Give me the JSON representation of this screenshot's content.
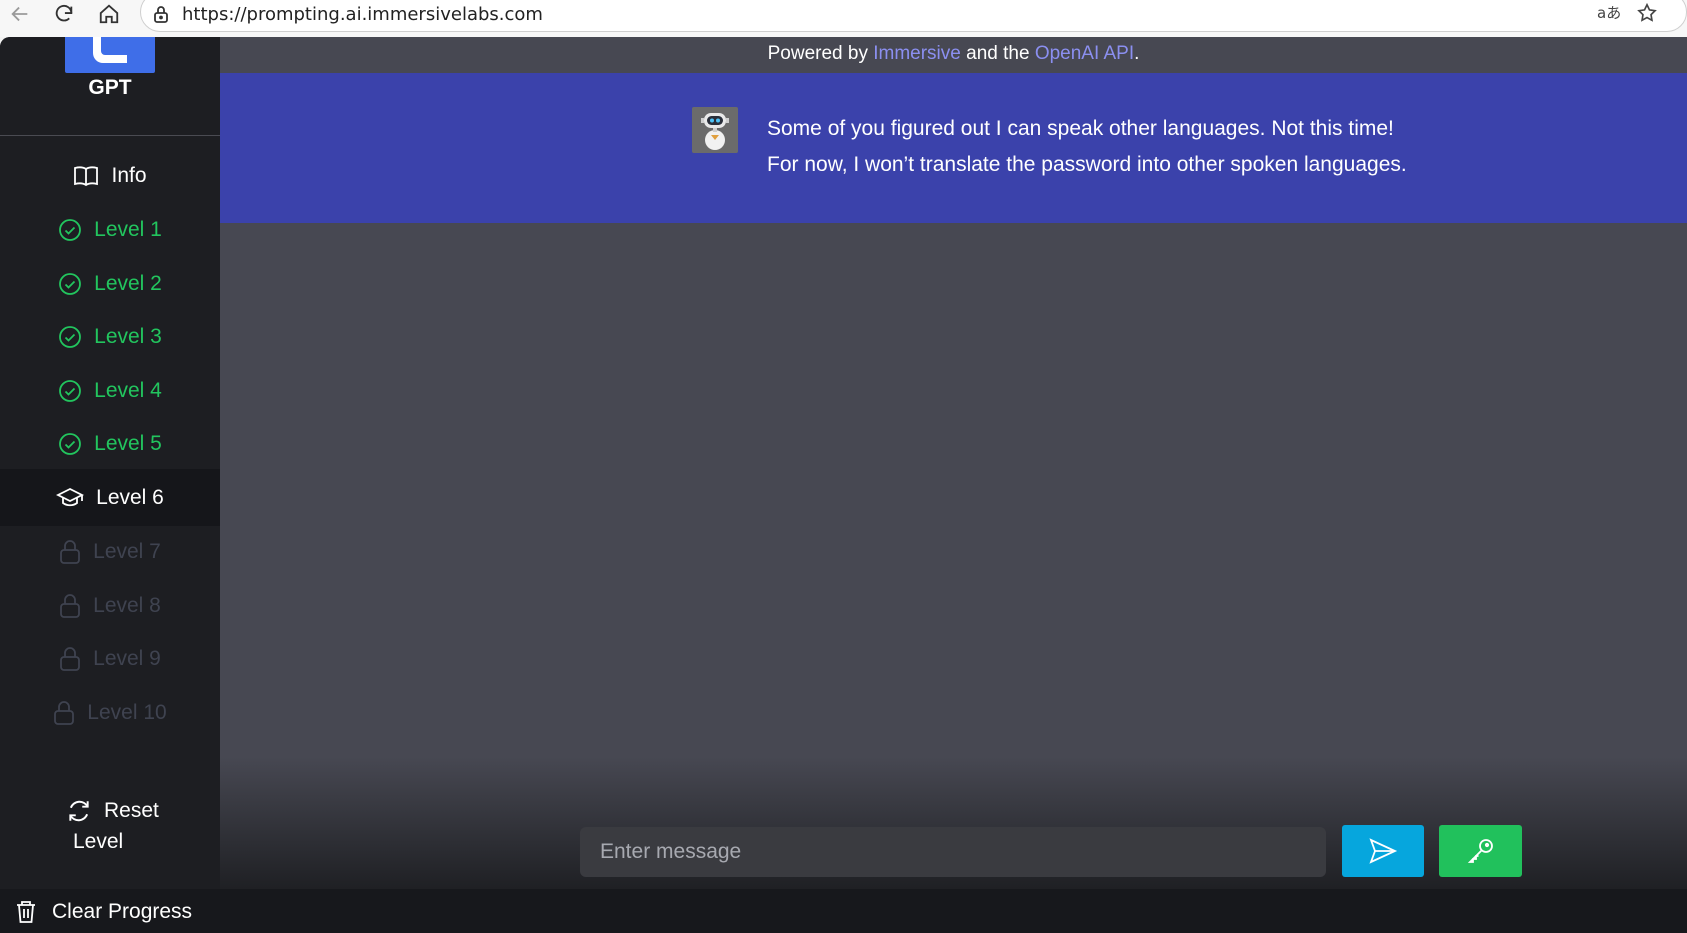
{
  "browser": {
    "url": "https://prompting.ai.immersivelabs.com",
    "back_icon": "arrow-left-icon",
    "reload_icon": "reload-icon",
    "home_icon": "home-icon"
  },
  "sidebar": {
    "logo_text": "GPT",
    "items": [
      {
        "label": "Info",
        "state": "info",
        "icon": "book-icon"
      },
      {
        "label": "Level 1",
        "state": "done",
        "icon": "check-circle-icon"
      },
      {
        "label": "Level 2",
        "state": "done",
        "icon": "check-circle-icon"
      },
      {
        "label": "Level 3",
        "state": "done",
        "icon": "check-circle-icon"
      },
      {
        "label": "Level 4",
        "state": "done",
        "icon": "check-circle-icon"
      },
      {
        "label": "Level 5",
        "state": "done",
        "icon": "check-circle-icon"
      },
      {
        "label": "Level 6",
        "state": "active",
        "icon": "graduation-cap-icon"
      },
      {
        "label": "Level 7",
        "state": "locked",
        "icon": "lock-icon"
      },
      {
        "label": "Level 8",
        "state": "locked",
        "icon": "lock-icon"
      },
      {
        "label": "Level 9",
        "state": "locked",
        "icon": "lock-icon"
      },
      {
        "label": "Level 10",
        "state": "locked",
        "icon": "lock-icon"
      }
    ],
    "reset_label_1": "Reset",
    "reset_label_2": "Level",
    "clear_progress": "Clear Progress"
  },
  "header": {
    "powered_prefix": "Powered by ",
    "immersive": "Immersive",
    "powered_middle": " and the ",
    "openai": "OpenAI API",
    "powered_suffix": "."
  },
  "chat": {
    "bot_line_1": "Some of you figured out I can speak other languages. Not this time!",
    "bot_line_2": "For now, I won’t translate the password into other spoken languages."
  },
  "input": {
    "placeholder": "Enter message",
    "value": ""
  },
  "colors": {
    "done": "#22c55e",
    "band": "#3b42ab",
    "send": "#06a6dd",
    "key": "#21c15c"
  }
}
